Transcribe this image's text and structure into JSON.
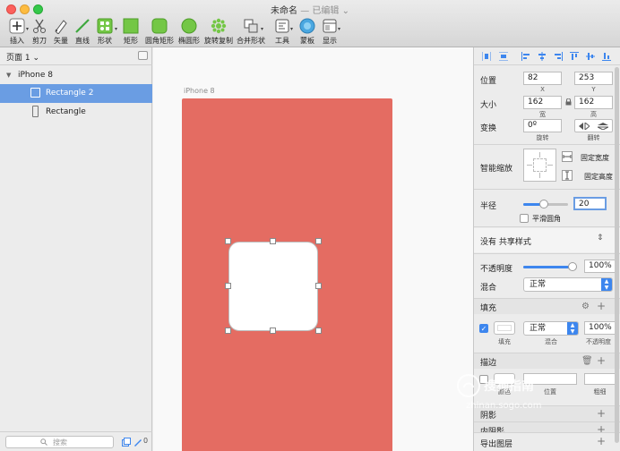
{
  "window": {
    "title": "未命名",
    "edited": " — 已编辑",
    "title_caret": "⌄"
  },
  "toolbar": {
    "insert": "插入",
    "scissors": "剪刀",
    "vector": "矢量",
    "line": "直线",
    "shape": "形状",
    "rect": "矩形",
    "rounded_rect": "圆角矩形",
    "oval": "椭圆形",
    "rotate_copy": "旋转复制",
    "combine": "合并形状",
    "tools": "工具",
    "mask": "蒙板",
    "view": "显示"
  },
  "layers": {
    "page_name": "页面 1",
    "page_caret": "⌄",
    "artboard": "iPhone 8",
    "items": [
      "Rectangle 2",
      "Rectangle"
    ],
    "search_placeholder": "搜索",
    "edited_count": "0"
  },
  "canvas": {
    "artboard_label": "iPhone 8"
  },
  "inspector": {
    "position_label": "位置",
    "pos_x": "82",
    "pos_y": "253",
    "x_label": "X",
    "y_label": "Y",
    "size_label": "大小",
    "width": "162",
    "height": "162",
    "w_label": "宽",
    "h_label": "高",
    "transform_label": "变换",
    "rotation": "0º",
    "rotate_label": "旋转",
    "flip_label": "翻转",
    "smart_resize_label": "智能缩放",
    "fix_width": "固定宽度",
    "fix_height": "固定高度",
    "radius_label": "半径",
    "radius_value": "20",
    "radius_slider": 0.45,
    "smooth_corners": "平滑圆角",
    "shared_style": "没有 共享样式",
    "opacity_label": "不透明度",
    "opacity_value": "100%",
    "opacity_slider": 1.0,
    "blend_label": "混合",
    "blend_value": "正常",
    "fill_header": "填充",
    "fill_blend": "正常",
    "fill_opacity": "100%",
    "fill_sub_fill": "填充",
    "fill_sub_blend": "混合",
    "fill_sub_opacity": "不透明度",
    "border_header": "描边",
    "border_sub_color": "颜色",
    "border_sub_position": "位置",
    "border_sub_width": "粗细",
    "shadow_header": "阴影",
    "inner_shadow_header": "内阴影",
    "export_header": "导出图层"
  },
  "watermark": {
    "text": "搜狗指南",
    "url": "zhinan.sogo.com"
  },
  "colors": {
    "artboard": "#e46c62",
    "accent": "#3d86ee",
    "selection": "#6a9de3"
  }
}
